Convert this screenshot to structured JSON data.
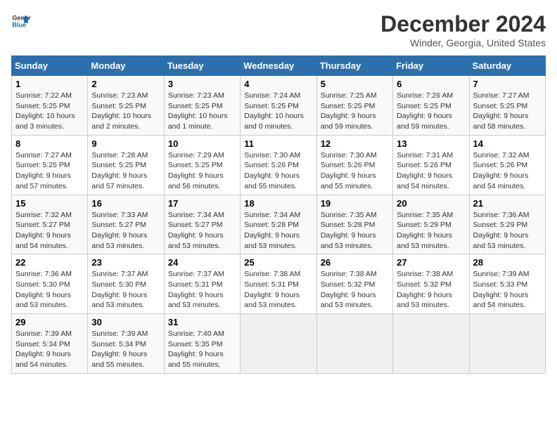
{
  "logo": {
    "text_general": "General",
    "text_blue": "Blue"
  },
  "title": "December 2024",
  "subtitle": "Winder, Georgia, United States",
  "days_of_week": [
    "Sunday",
    "Monday",
    "Tuesday",
    "Wednesday",
    "Thursday",
    "Friday",
    "Saturday"
  ],
  "weeks": [
    [
      {
        "day": "1",
        "info": "Sunrise: 7:22 AM\nSunset: 5:25 PM\nDaylight: 10 hours\nand 3 minutes."
      },
      {
        "day": "2",
        "info": "Sunrise: 7:23 AM\nSunset: 5:25 PM\nDaylight: 10 hours\nand 2 minutes."
      },
      {
        "day": "3",
        "info": "Sunrise: 7:23 AM\nSunset: 5:25 PM\nDaylight: 10 hours\nand 1 minute."
      },
      {
        "day": "4",
        "info": "Sunrise: 7:24 AM\nSunset: 5:25 PM\nDaylight: 10 hours\nand 0 minutes."
      },
      {
        "day": "5",
        "info": "Sunrise: 7:25 AM\nSunset: 5:25 PM\nDaylight: 9 hours\nand 59 minutes."
      },
      {
        "day": "6",
        "info": "Sunrise: 7:26 AM\nSunset: 5:25 PM\nDaylight: 9 hours\nand 59 minutes."
      },
      {
        "day": "7",
        "info": "Sunrise: 7:27 AM\nSunset: 5:25 PM\nDaylight: 9 hours\nand 58 minutes."
      }
    ],
    [
      {
        "day": "8",
        "info": "Sunrise: 7:27 AM\nSunset: 5:25 PM\nDaylight: 9 hours\nand 57 minutes."
      },
      {
        "day": "9",
        "info": "Sunrise: 7:28 AM\nSunset: 5:25 PM\nDaylight: 9 hours\nand 57 minutes."
      },
      {
        "day": "10",
        "info": "Sunrise: 7:29 AM\nSunset: 5:25 PM\nDaylight: 9 hours\nand 56 minutes."
      },
      {
        "day": "11",
        "info": "Sunrise: 7:30 AM\nSunset: 5:26 PM\nDaylight: 9 hours\nand 55 minutes."
      },
      {
        "day": "12",
        "info": "Sunrise: 7:30 AM\nSunset: 5:26 PM\nDaylight: 9 hours\nand 55 minutes."
      },
      {
        "day": "13",
        "info": "Sunrise: 7:31 AM\nSunset: 5:26 PM\nDaylight: 9 hours\nand 54 minutes."
      },
      {
        "day": "14",
        "info": "Sunrise: 7:32 AM\nSunset: 5:26 PM\nDaylight: 9 hours\nand 54 minutes."
      }
    ],
    [
      {
        "day": "15",
        "info": "Sunrise: 7:32 AM\nSunset: 5:27 PM\nDaylight: 9 hours\nand 54 minutes."
      },
      {
        "day": "16",
        "info": "Sunrise: 7:33 AM\nSunset: 5:27 PM\nDaylight: 9 hours\nand 53 minutes."
      },
      {
        "day": "17",
        "info": "Sunrise: 7:34 AM\nSunset: 5:27 PM\nDaylight: 9 hours\nand 53 minutes."
      },
      {
        "day": "18",
        "info": "Sunrise: 7:34 AM\nSunset: 5:28 PM\nDaylight: 9 hours\nand 53 minutes."
      },
      {
        "day": "19",
        "info": "Sunrise: 7:35 AM\nSunset: 5:28 PM\nDaylight: 9 hours\nand 53 minutes."
      },
      {
        "day": "20",
        "info": "Sunrise: 7:35 AM\nSunset: 5:29 PM\nDaylight: 9 hours\nand 53 minutes."
      },
      {
        "day": "21",
        "info": "Sunrise: 7:36 AM\nSunset: 5:29 PM\nDaylight: 9 hours\nand 53 minutes."
      }
    ],
    [
      {
        "day": "22",
        "info": "Sunrise: 7:36 AM\nSunset: 5:30 PM\nDaylight: 9 hours\nand 53 minutes."
      },
      {
        "day": "23",
        "info": "Sunrise: 7:37 AM\nSunset: 5:30 PM\nDaylight: 9 hours\nand 53 minutes."
      },
      {
        "day": "24",
        "info": "Sunrise: 7:37 AM\nSunset: 5:31 PM\nDaylight: 9 hours\nand 53 minutes."
      },
      {
        "day": "25",
        "info": "Sunrise: 7:38 AM\nSunset: 5:31 PM\nDaylight: 9 hours\nand 53 minutes."
      },
      {
        "day": "26",
        "info": "Sunrise: 7:38 AM\nSunset: 5:32 PM\nDaylight: 9 hours\nand 53 minutes."
      },
      {
        "day": "27",
        "info": "Sunrise: 7:38 AM\nSunset: 5:32 PM\nDaylight: 9 hours\nand 53 minutes."
      },
      {
        "day": "28",
        "info": "Sunrise: 7:39 AM\nSunset: 5:33 PM\nDaylight: 9 hours\nand 54 minutes."
      }
    ],
    [
      {
        "day": "29",
        "info": "Sunrise: 7:39 AM\nSunset: 5:34 PM\nDaylight: 9 hours\nand 54 minutes."
      },
      {
        "day": "30",
        "info": "Sunrise: 7:39 AM\nSunset: 5:34 PM\nDaylight: 9 hours\nand 55 minutes."
      },
      {
        "day": "31",
        "info": "Sunrise: 7:40 AM\nSunset: 5:35 PM\nDaylight: 9 hours\nand 55 minutes."
      },
      {
        "day": "",
        "info": ""
      },
      {
        "day": "",
        "info": ""
      },
      {
        "day": "",
        "info": ""
      },
      {
        "day": "",
        "info": ""
      }
    ]
  ]
}
